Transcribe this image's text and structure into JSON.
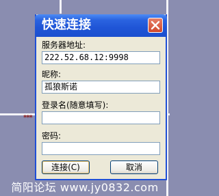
{
  "dialog": {
    "title": "快速连接",
    "server_label": "服务器地址:",
    "server_value": "222.52.68.12:9998",
    "nickname_label": "昵称:",
    "nickname_value": "孤狼斯诺",
    "login_label": "登录名(随意填写):",
    "login_value": "",
    "password_label": "密码:",
    "password_value": "",
    "connect_button": "连接(C)",
    "cancel_button": "取消"
  },
  "background": {
    "asterisks": "***"
  },
  "watermark": "简阳论坛 www.jy0832.com",
  "colors": {
    "titlebar": "#2a63e0",
    "dialog_bg": "#ece9d8",
    "close_button": "#d0482c",
    "desktop": "#8a8db0"
  },
  "icons": {
    "close": "close-icon"
  }
}
